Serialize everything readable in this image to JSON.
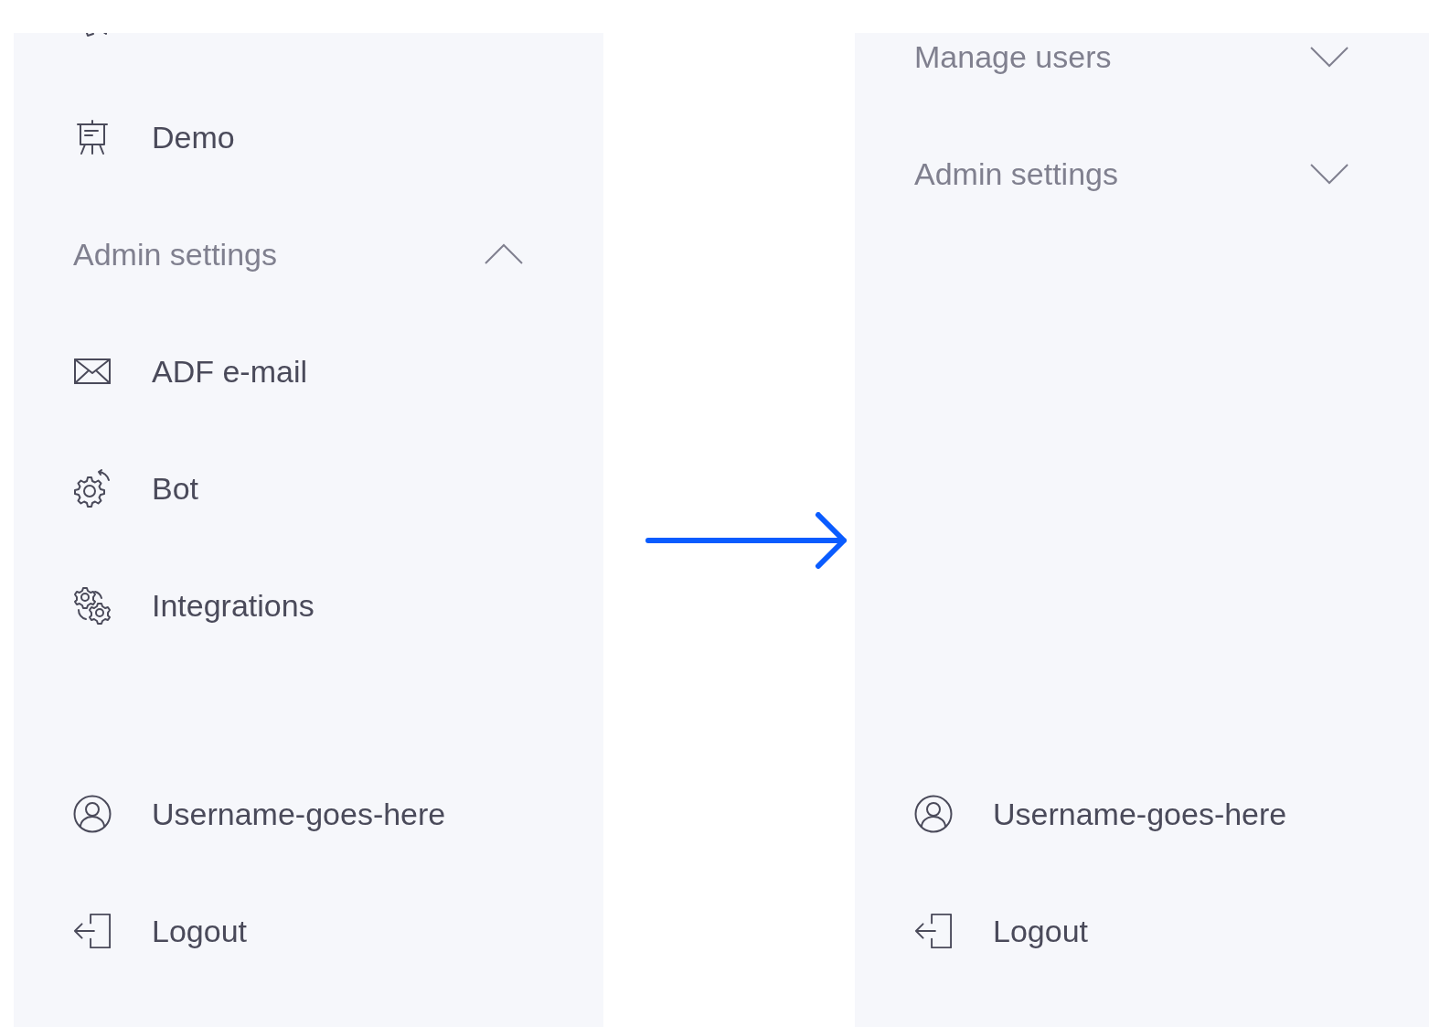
{
  "panels": [
    {
      "items": [
        {
          "kind": "link",
          "label": "Demo"
        },
        {
          "kind": "section",
          "label": "Admin settings",
          "expanded": true,
          "children": [
            {
              "label": "ADF e-mail"
            },
            {
              "label": "Bot"
            },
            {
              "label": "Integrations"
            }
          ]
        }
      ],
      "footer": [
        {
          "label": "Username-goes-here"
        },
        {
          "label": "Logout"
        }
      ]
    },
    {
      "items": [
        {
          "kind": "section",
          "label": "Manage users",
          "expanded": false
        },
        {
          "kind": "section",
          "label": "Admin settings",
          "expanded": false
        }
      ],
      "footer": [
        {
          "label": "Username-goes-here"
        },
        {
          "label": "Logout"
        }
      ]
    }
  ]
}
